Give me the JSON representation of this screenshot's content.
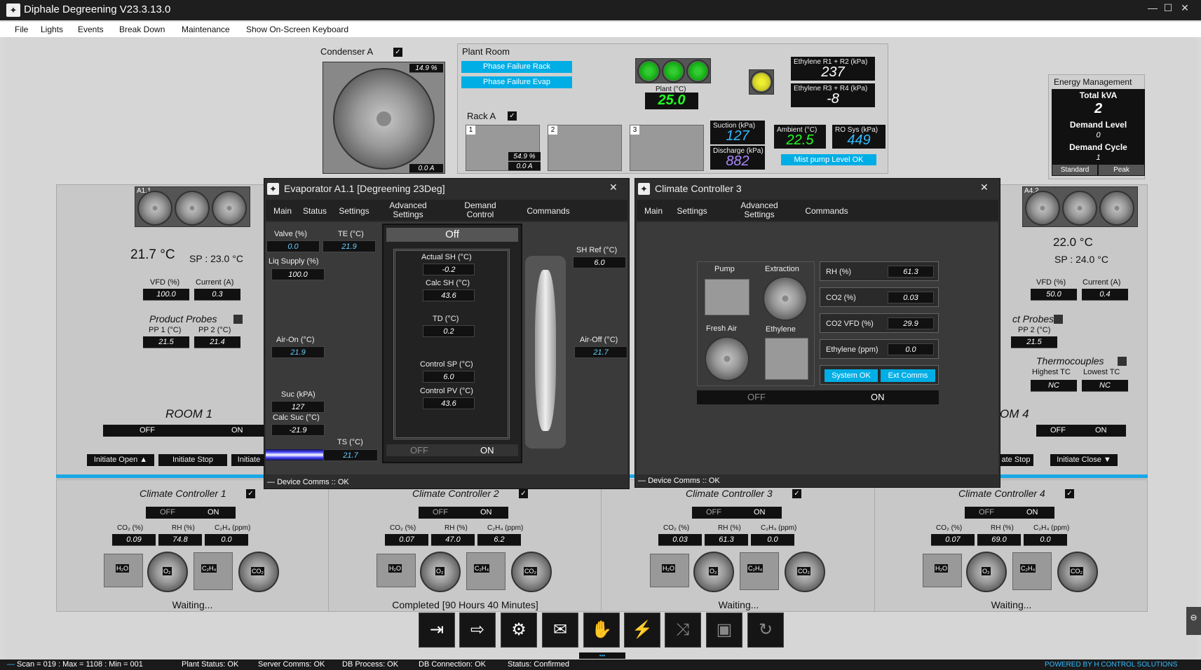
{
  "app": {
    "title": "Diphale Degreening V23.3.13.0"
  },
  "menu": [
    "File",
    "Lights",
    "Events",
    "Break Down",
    "Maintenance",
    "Show On-Screen Keyboard"
  ],
  "condenser": {
    "title": "Condenser A",
    "pct": "14.9",
    "pct_unit": "%",
    "amps": "0.0",
    "amps_unit": "A"
  },
  "plant": {
    "title": "Plant Room",
    "phase_rack": "Phase Failure Rack",
    "phase_evap": "Phase Failure Evap",
    "plant_label": "Plant (°C)",
    "plant_val": "25.0",
    "eth12_label": "Ethylene R1 + R2 (kPa)",
    "eth12_val": "237",
    "eth34_label": "Ethylene R3 + R4 (kPa)",
    "eth34_val": "-8"
  },
  "rack": {
    "title": "Rack A",
    "c1": "1",
    "c2": "2",
    "c3": "3",
    "pct": "54.9",
    "pct_unit": "%",
    "amps": "0.0",
    "amps_unit": "A",
    "suction_label": "Suction (kPa)",
    "suction_val": "127",
    "discharge_label": "Discharge (kPa)",
    "discharge_val": "882",
    "ambient_label": "Ambient (°C)",
    "ambient_val": "22.5",
    "ro_label": "RO Sys (kPa)",
    "ro_val": "449",
    "mist": "Mist pump Level OK"
  },
  "energy": {
    "title": "Energy Management",
    "kva_label": "Total kVA",
    "kva_val": "2",
    "dl_label": "Demand Level",
    "dl_val": "0",
    "dc_label": "Demand Cycle",
    "dc_val": "1",
    "standard": "Standard",
    "peak": "Peak"
  },
  "room1": {
    "fans": "A1.1",
    "temp": "21.7 °C",
    "sp": "SP : 23.0 °C",
    "vfd_label": "VFD (%)",
    "vfd": "100.0",
    "cur_label": "Current (A)",
    "cur": "0.3",
    "probes": "Product Probes",
    "pp1_label": "PP 1 (°C)",
    "pp1": "21.5",
    "pp2_label": "PP 2 (°C)",
    "pp2": "21.4",
    "name": "ROOM 1",
    "off": "OFF",
    "on": "ON",
    "open": "Initiate Open ▲",
    "stop": "Initiate Stop",
    "initiate": "Initiate"
  },
  "room4": {
    "fans": "A4.2",
    "temp": "22.0 °C",
    "sp": "SP : 24.0 °C",
    "vfd_label": "VFD (%)",
    "vfd": "50.0",
    "cur_label": "Current (A)",
    "cur": "0.4",
    "probes": "ct Probes",
    "pp2_label": "PP 2 (°C)",
    "pp2": "21.5",
    "tc": "Thermocouples",
    "hi_label": "Highest TC",
    "hi": "NC",
    "lo_label": "Lowest TC",
    "lo": "NC",
    "name": "OM 4",
    "off": "OFF",
    "on": "ON",
    "stop": "ate Stop",
    "close": "Initiate Close ▼"
  },
  "evap": {
    "title": "Evaporator A1.1 [Degreening 23Deg]",
    "tabs": [
      "Main",
      "Status",
      "Settings",
      "Advanced Settings",
      "Demand Control",
      "Commands"
    ],
    "valve_label": "Valve (%)",
    "valve": "0.0",
    "te_label": "TE (°C)",
    "te": "21.9",
    "liq_label": "Liq Supply (%)",
    "liq": "100.0",
    "airon_label": "Air-On (°C)",
    "airon": "21.9",
    "suc_label": "Suc (kPA)",
    "suc": "127",
    "calcsuc_label": "Calc Suc (°C)",
    "calcsuc": "-21.9",
    "ts_label": "TS (°C)",
    "ts": "21.7",
    "state": "Off",
    "actsh_label": "Actual SH (°C)",
    "actsh": "-0.2",
    "calcsh_label": "Calc SH (°C)",
    "calcsh": "43.6",
    "td_label": "TD (°C)",
    "td": "0.2",
    "csp_label": "Control SP (°C)",
    "csp": "6.0",
    "cpv_label": "Control PV (°C)",
    "cpv": "43.6",
    "off": "OFF",
    "on": "ON",
    "shref_label": "SH Ref (°C)",
    "shref": "6.0",
    "airoff_label": "Air-Off (°C)",
    "airoff": "21.7",
    "comms": "Device Comms :: OK"
  },
  "clim3": {
    "title": "Climate Controller 3",
    "tabs": [
      "Main",
      "Settings",
      "Advanced Settings",
      "Commands"
    ],
    "pump": "Pump",
    "extraction": "Extraction",
    "fresh": "Fresh Air",
    "ethylene": "Ethylene",
    "rh_label": "RH (%)",
    "rh": "61.3",
    "co2_label": "CO2 (%)",
    "co2": "0.03",
    "co2vfd_label": "CO2 VFD (%)",
    "co2vfd": "29.9",
    "eth_label": "Ethylene (ppm)",
    "eth": "0.0",
    "sysok": "System OK",
    "extcomms": "Ext Comms",
    "off": "OFF",
    "on": "ON",
    "comms": "Device Comms :: OK"
  },
  "ccs": [
    {
      "title": "Climate Controller 1",
      "co2": "0.09",
      "rh": "74.8",
      "c2h4": "0.0",
      "status": "Waiting..."
    },
    {
      "title": "Climate Controller 2",
      "co2": "0.07",
      "rh": "47.0",
      "c2h4": "6.2",
      "status": "Completed [90 Hours 40 Minutes]"
    },
    {
      "title": "Climate Controller 3",
      "co2": "0.03",
      "rh": "61.3",
      "c2h4": "0.0",
      "status": "Waiting..."
    },
    {
      "title": "Climate Controller 4",
      "co2": "0.07",
      "rh": "69.0",
      "c2h4": "0.0",
      "status": "Waiting..."
    }
  ],
  "cc_labels": {
    "co2": "CO₂ (%)",
    "rh": "RH (%)",
    "c2h4": "C₂H₄ (ppm)",
    "off": "OFF",
    "on": "ON",
    "h2o": "H₂O",
    "o2": "O₂",
    "c2h4_icon": "C₂H₄",
    "co2_icon": "CO₂"
  },
  "toolbar": [
    "login-icon",
    "logout-icon",
    "users-icon",
    "mail-icon",
    "hand-icon",
    "lightning-icon",
    "shuffle-icon",
    "save-icon",
    "refresh-icon"
  ],
  "status": {
    "scan": "Scan = 019 : Max = 1108 : Min = 001",
    "plant": "Plant Status: OK",
    "server": "Server Comms: OK",
    "db": "DB Process: OK",
    "dbconn": "DB Connection: OK",
    "state": "Status: Confirmed",
    "powered": "POWERED BY H CONTROL SOLUTIONS"
  }
}
